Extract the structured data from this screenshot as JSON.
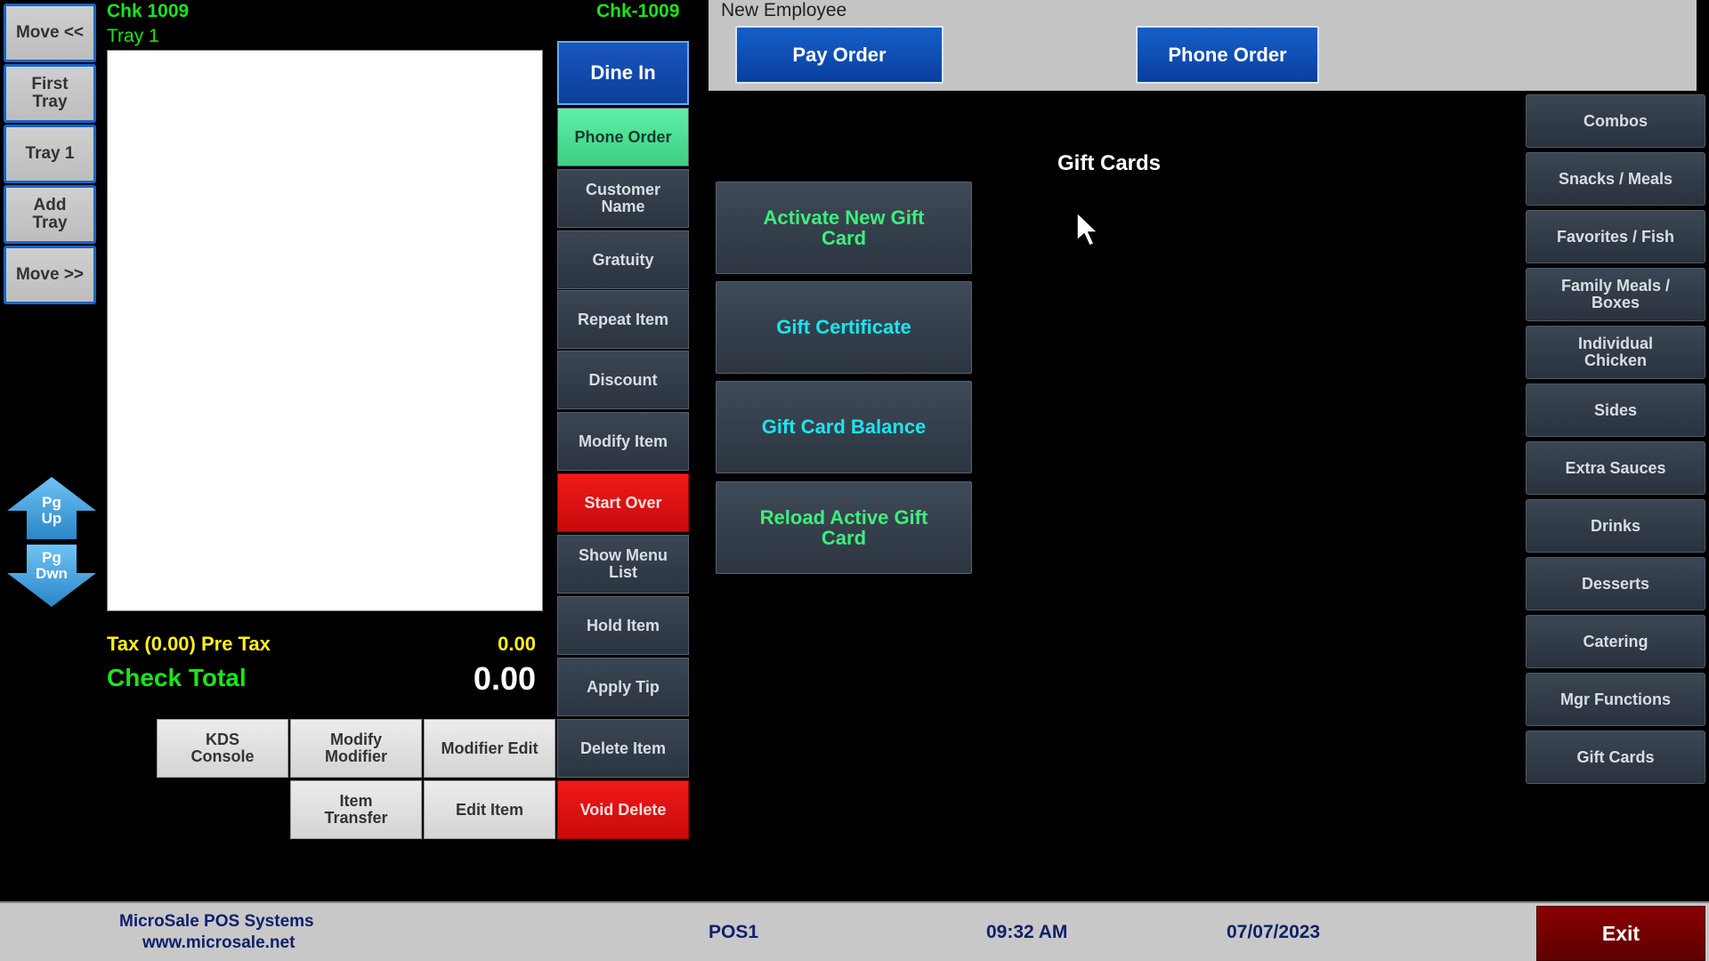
{
  "left_nav": {
    "move_left": "Move <<",
    "first_tray": "First\nTray",
    "tray_1": "Tray 1",
    "add_tray": "Add\nTray",
    "move_right": "Move >>",
    "pg_up": "Pg\nUp",
    "pg_down": "Pg\nDwn"
  },
  "check": {
    "chk_left": "Chk  1009",
    "chk_right": "Chk-1009",
    "tray": "Tray 1",
    "tax_label": "Tax (0.00)  Pre Tax",
    "tax_value": "0.00",
    "total_label": "Check Total",
    "total_value": "0.00"
  },
  "functions": {
    "dine_in": "Dine In",
    "phone_order": "Phone Order",
    "customer_name": "Customer\nName",
    "gratuity": "Gratuity",
    "repeat_item": "Repeat Item",
    "discount": "Discount",
    "modify_item": "Modify Item",
    "start_over": "Start Over",
    "show_menu_list": "Show Menu\nList",
    "hold_item": "Hold Item",
    "apply_tip": "Apply Tip",
    "delete_item": "Delete Item",
    "void_delete": "Void Delete"
  },
  "bottom_buttons": {
    "kds_console": "KDS\nConsole",
    "modify_modifier": "Modify\nModifier",
    "modifier_edit": "Modifier Edit",
    "item_transfer": "Item\nTransfer",
    "edit_item": "Edit Item"
  },
  "header": {
    "employee": "New Employee",
    "pay_order": "Pay Order",
    "phone_order": "Phone Order"
  },
  "gift_cards": {
    "title": "Gift Cards",
    "activate": "Activate New Gift\nCard",
    "certificate": "Gift Certificate",
    "balance": "Gift Card Balance",
    "reload": "Reload Active Gift\nCard"
  },
  "categories": [
    "Combos",
    "Snacks / Meals",
    "Favorites / Fish",
    "Family Meals /\nBoxes",
    "Individual\nChicken",
    "Sides",
    "Extra Sauces",
    "Drinks",
    "Desserts",
    "Catering",
    "Mgr Functions",
    "Gift Cards"
  ],
  "footer": {
    "company": "MicroSale POS Systems",
    "website": "www.microsale.net",
    "station": "POS1",
    "time": "09:32 AM",
    "date": "07/07/2023",
    "exit": "Exit"
  },
  "colors": {
    "green_text": "#19e619",
    "yellow_text": "#ffef1a",
    "tile_green": "#3cf07a",
    "tile_cyan": "#19e6f0",
    "accent_blue": "#0b3f98",
    "exit_red": "#7a0000"
  },
  "icons": [
    "pg-up-arrow-icon",
    "pg-down-arrow-icon",
    "mouse-cursor-icon"
  ]
}
